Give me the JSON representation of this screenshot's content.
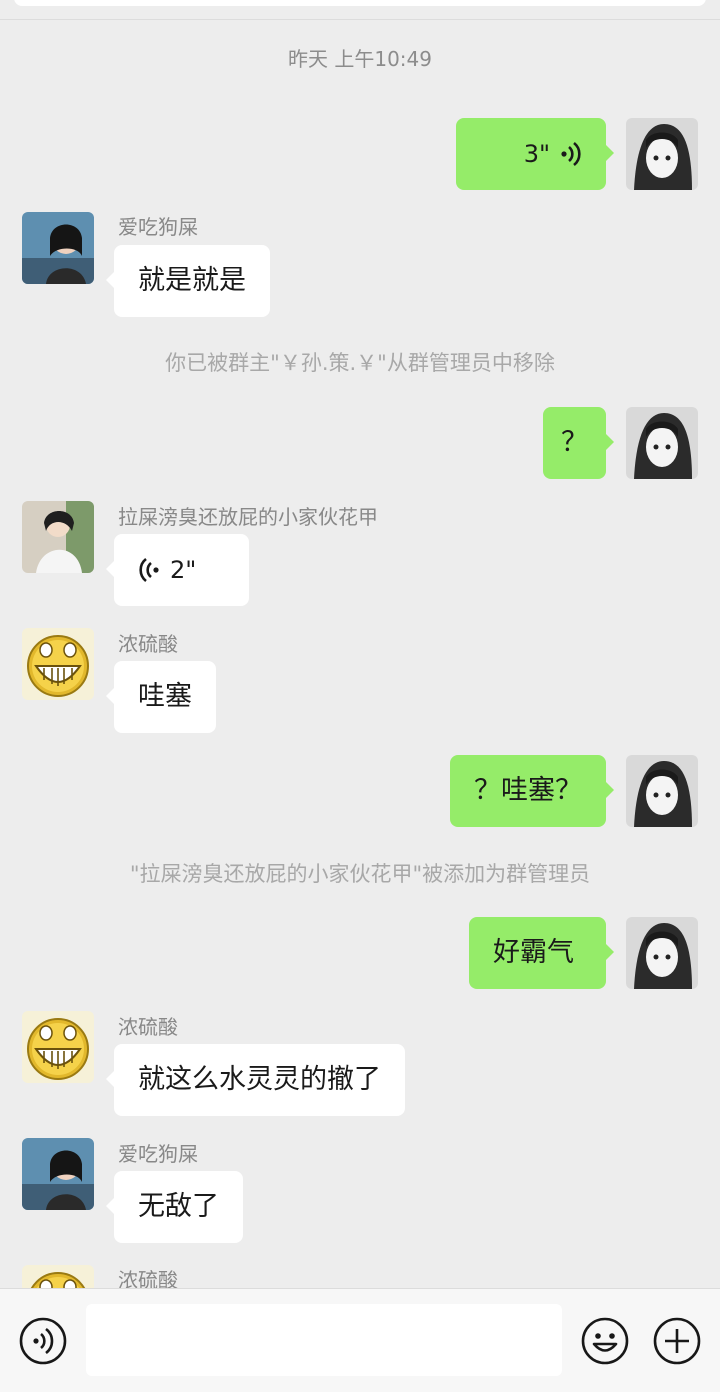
{
  "timestamp": "昨天 上午10:49",
  "messages": [
    {
      "kind": "voice-out",
      "duration": "3\""
    },
    {
      "kind": "text-in",
      "sender": "爱吃狗屎",
      "text": "就是就是"
    },
    {
      "kind": "system",
      "text": "你已被群主\"￥孙.策.￥\"从群管理员中移除"
    },
    {
      "kind": "text-out",
      "text": "？"
    },
    {
      "kind": "voice-in",
      "sender": "拉屎滂臭还放屁的小家伙花甲",
      "duration": "2\""
    },
    {
      "kind": "text-in",
      "sender": "浓硫酸",
      "text": "哇塞"
    },
    {
      "kind": "text-out",
      "text": "？哇塞？"
    },
    {
      "kind": "system",
      "text": "\"拉屎滂臭还放屁的小家伙花甲\"被添加为群管理员"
    },
    {
      "kind": "text-out",
      "text": "好霸气"
    },
    {
      "kind": "text-in",
      "sender": "浓硫酸",
      "text": "就这么水灵灵的撤了"
    },
    {
      "kind": "text-in",
      "sender": "爱吃狗屎",
      "text": "无敌了"
    },
    {
      "kind": "partial-in",
      "sender": "浓硫酸"
    }
  ],
  "input": {
    "value": ""
  },
  "icons": {
    "voice_toggle": "voice-input-icon",
    "emoji": "emoji-icon",
    "more": "plus-icon"
  },
  "colors": {
    "background": "#ededed",
    "outgoing_bubble": "#95ec69",
    "incoming_bubble": "#ffffff",
    "system_text": "#a8a8a8"
  }
}
